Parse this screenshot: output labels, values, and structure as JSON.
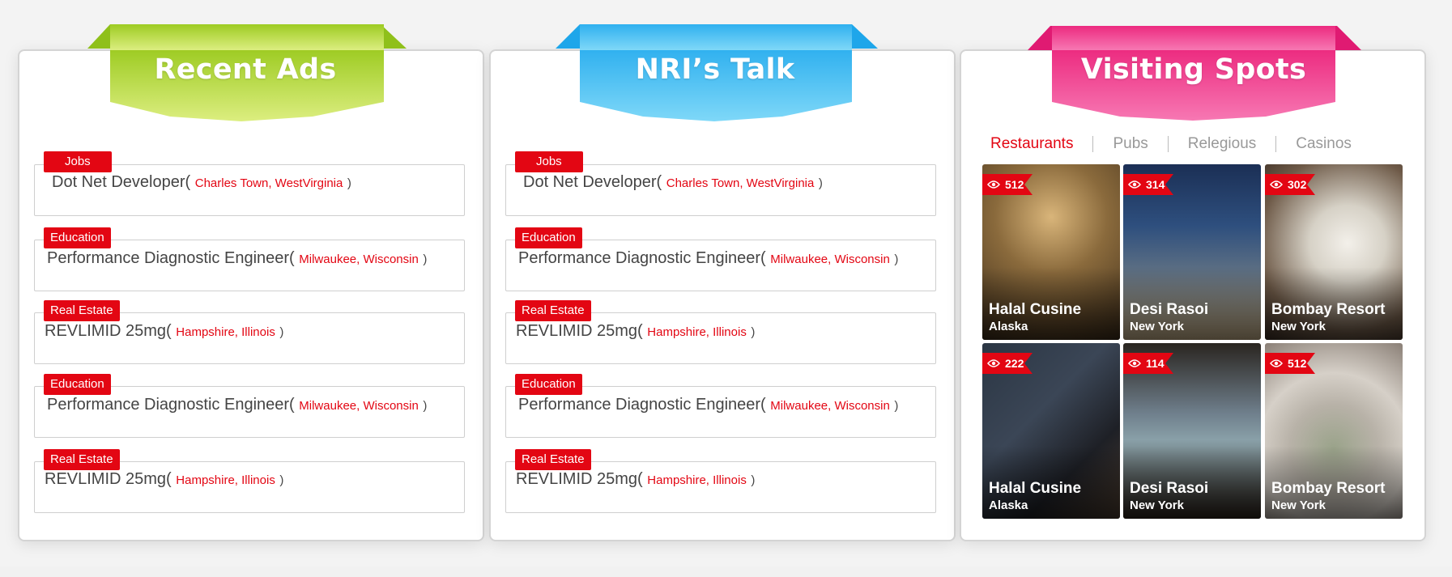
{
  "panels": {
    "recent_ads": {
      "title": "Recent Ads",
      "items": [
        {
          "tag": "Jobs",
          "text": "Dot Net Developer(",
          "location": "Charles Town, WestVirginia",
          "close": ")"
        },
        {
          "tag": "Education",
          "text": "Performance Diagnostic Engineer(",
          "location": "Milwaukee, Wisconsin",
          "close": ")"
        },
        {
          "tag": "Real Estate",
          "text": "REVLIMID 25mg(",
          "location": "Hampshire, Illinois",
          "close": ")"
        },
        {
          "tag": "Education",
          "text": "Performance Diagnostic Engineer(",
          "location": "Milwaukee, Wisconsin",
          "close": ")"
        },
        {
          "tag": "Real Estate",
          "text": "REVLIMID 25mg(",
          "location": "Hampshire, Illinois",
          "close": ")"
        }
      ]
    },
    "nri_talk": {
      "title": "NRI’s Talk",
      "items": [
        {
          "tag": "Jobs",
          "text": "Dot Net Developer(",
          "location": "Charles Town, WestVirginia",
          "close": ")"
        },
        {
          "tag": "Education",
          "text": "Performance Diagnostic Engineer(",
          "location": "Milwaukee, Wisconsin",
          "close": ")"
        },
        {
          "tag": "Real Estate",
          "text": "REVLIMID 25mg(",
          "location": "Hampshire, Illinois",
          "close": ")"
        },
        {
          "tag": "Education",
          "text": "Performance Diagnostic Engineer(",
          "location": "Milwaukee, Wisconsin",
          "close": ")"
        },
        {
          "tag": "Real Estate",
          "text": "REVLIMID 25mg(",
          "location": "Hampshire, Illinois",
          "close": ")"
        }
      ]
    },
    "visiting_spots": {
      "title": "Visiting Spots",
      "tabs": [
        "Restaurants",
        "Pubs",
        "Relegious",
        "Casinos"
      ],
      "active_tab": "Restaurants",
      "spots": [
        {
          "views": "512",
          "name": "Halal Cusine",
          "location": "Alaska",
          "icon": "eye-icon"
        },
        {
          "views": "314",
          "name": "Desi Rasoi",
          "location": "New York",
          "icon": "eye-icon"
        },
        {
          "views": "302",
          "name": "Bombay Resort",
          "location": "New York",
          "icon": "eye-icon"
        },
        {
          "views": "222",
          "name": "Halal Cusine",
          "location": "Alaska",
          "icon": "eye-icon"
        },
        {
          "views": "114",
          "name": "Desi Rasoi",
          "location": "New York",
          "icon": "eye-icon"
        },
        {
          "views": "512",
          "name": "Bombay Resort",
          "location": "New York",
          "icon": "eye-icon"
        }
      ]
    }
  },
  "colors": {
    "accent_red": "#e30613",
    "green_ribbon": "#a4cf2b",
    "blue_ribbon": "#3fb6f0",
    "pink_ribbon": "#ee2d84"
  }
}
